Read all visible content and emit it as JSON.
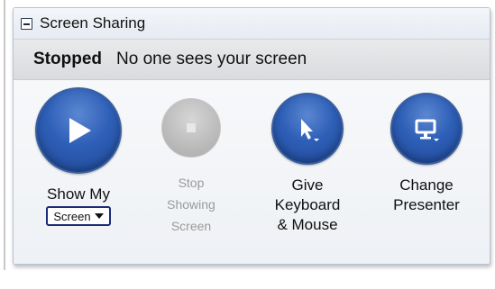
{
  "panel": {
    "title": "Screen Sharing",
    "status": {
      "state": "Stopped",
      "message": "No one sees your screen"
    }
  },
  "actions": {
    "show": {
      "label": "Show My",
      "select_value": "Screen"
    },
    "stop": {
      "line1": "Stop",
      "line2": "Showing",
      "line3": "Screen"
    },
    "give": {
      "line1": "Give",
      "line2": "Keyboard",
      "line3": "& Mouse"
    },
    "change": {
      "line1": "Change",
      "line2": "Presenter"
    }
  },
  "icons": {
    "show": "play-icon",
    "stop": "stop-icon",
    "give": "cursor-dropdown-icon",
    "change": "monitor-dropdown-icon"
  },
  "colors": {
    "accent_blue": "#2e5fb7",
    "disabled_grey": "#bdbdbd"
  }
}
